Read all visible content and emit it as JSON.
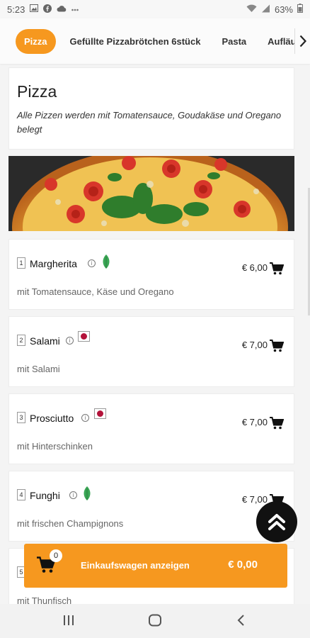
{
  "status_bar": {
    "time": "5:23",
    "battery": "63%",
    "icons": [
      "gallery-icon",
      "facebook-icon",
      "cloud-icon",
      "more-dots-icon",
      "wifi-icon",
      "signal-icon",
      "battery-icon"
    ]
  },
  "tabs": [
    {
      "label": "Pizza",
      "active": true
    },
    {
      "label": "Gefüllte Pizzabrötchen 6stück",
      "active": false
    },
    {
      "label": "Pasta",
      "active": false
    },
    {
      "label": "Aufläufe",
      "active": false
    }
  ],
  "category": {
    "title": "Pizza",
    "description": "Alle Pizzen werden mit Tomatensauce, Goudakäse und Oregano belegt"
  },
  "items": [
    {
      "number": "1",
      "name": "Margherita",
      "badge": "vegetarian-leaf-icon",
      "price": "€ 6,00",
      "description": "mit Tomatensauce, Käse und Oregano"
    },
    {
      "number": "2",
      "name": "Salami",
      "badge": "meat-icon",
      "price": "€ 7,00",
      "description": "mit Salami"
    },
    {
      "number": "3",
      "name": "Prosciutto",
      "badge": "meat-icon",
      "price": "€ 7,00",
      "description": "mit Hinterschinken"
    },
    {
      "number": "4",
      "name": "Funghi",
      "badge": "vegetarian-leaf-icon",
      "price": "€ 7,00",
      "description": "mit frischen Champignons"
    },
    {
      "number": "5",
      "name": "",
      "badge": "",
      "price": "",
      "description": "mit Thunfisch"
    }
  ],
  "cart": {
    "count": "0",
    "label": "Einkaufswagen anzeigen",
    "total": "€ 0,00"
  },
  "colors": {
    "accent": "#f6981f",
    "veg_green": "#3aa655",
    "meat_red": "#b3123a"
  }
}
